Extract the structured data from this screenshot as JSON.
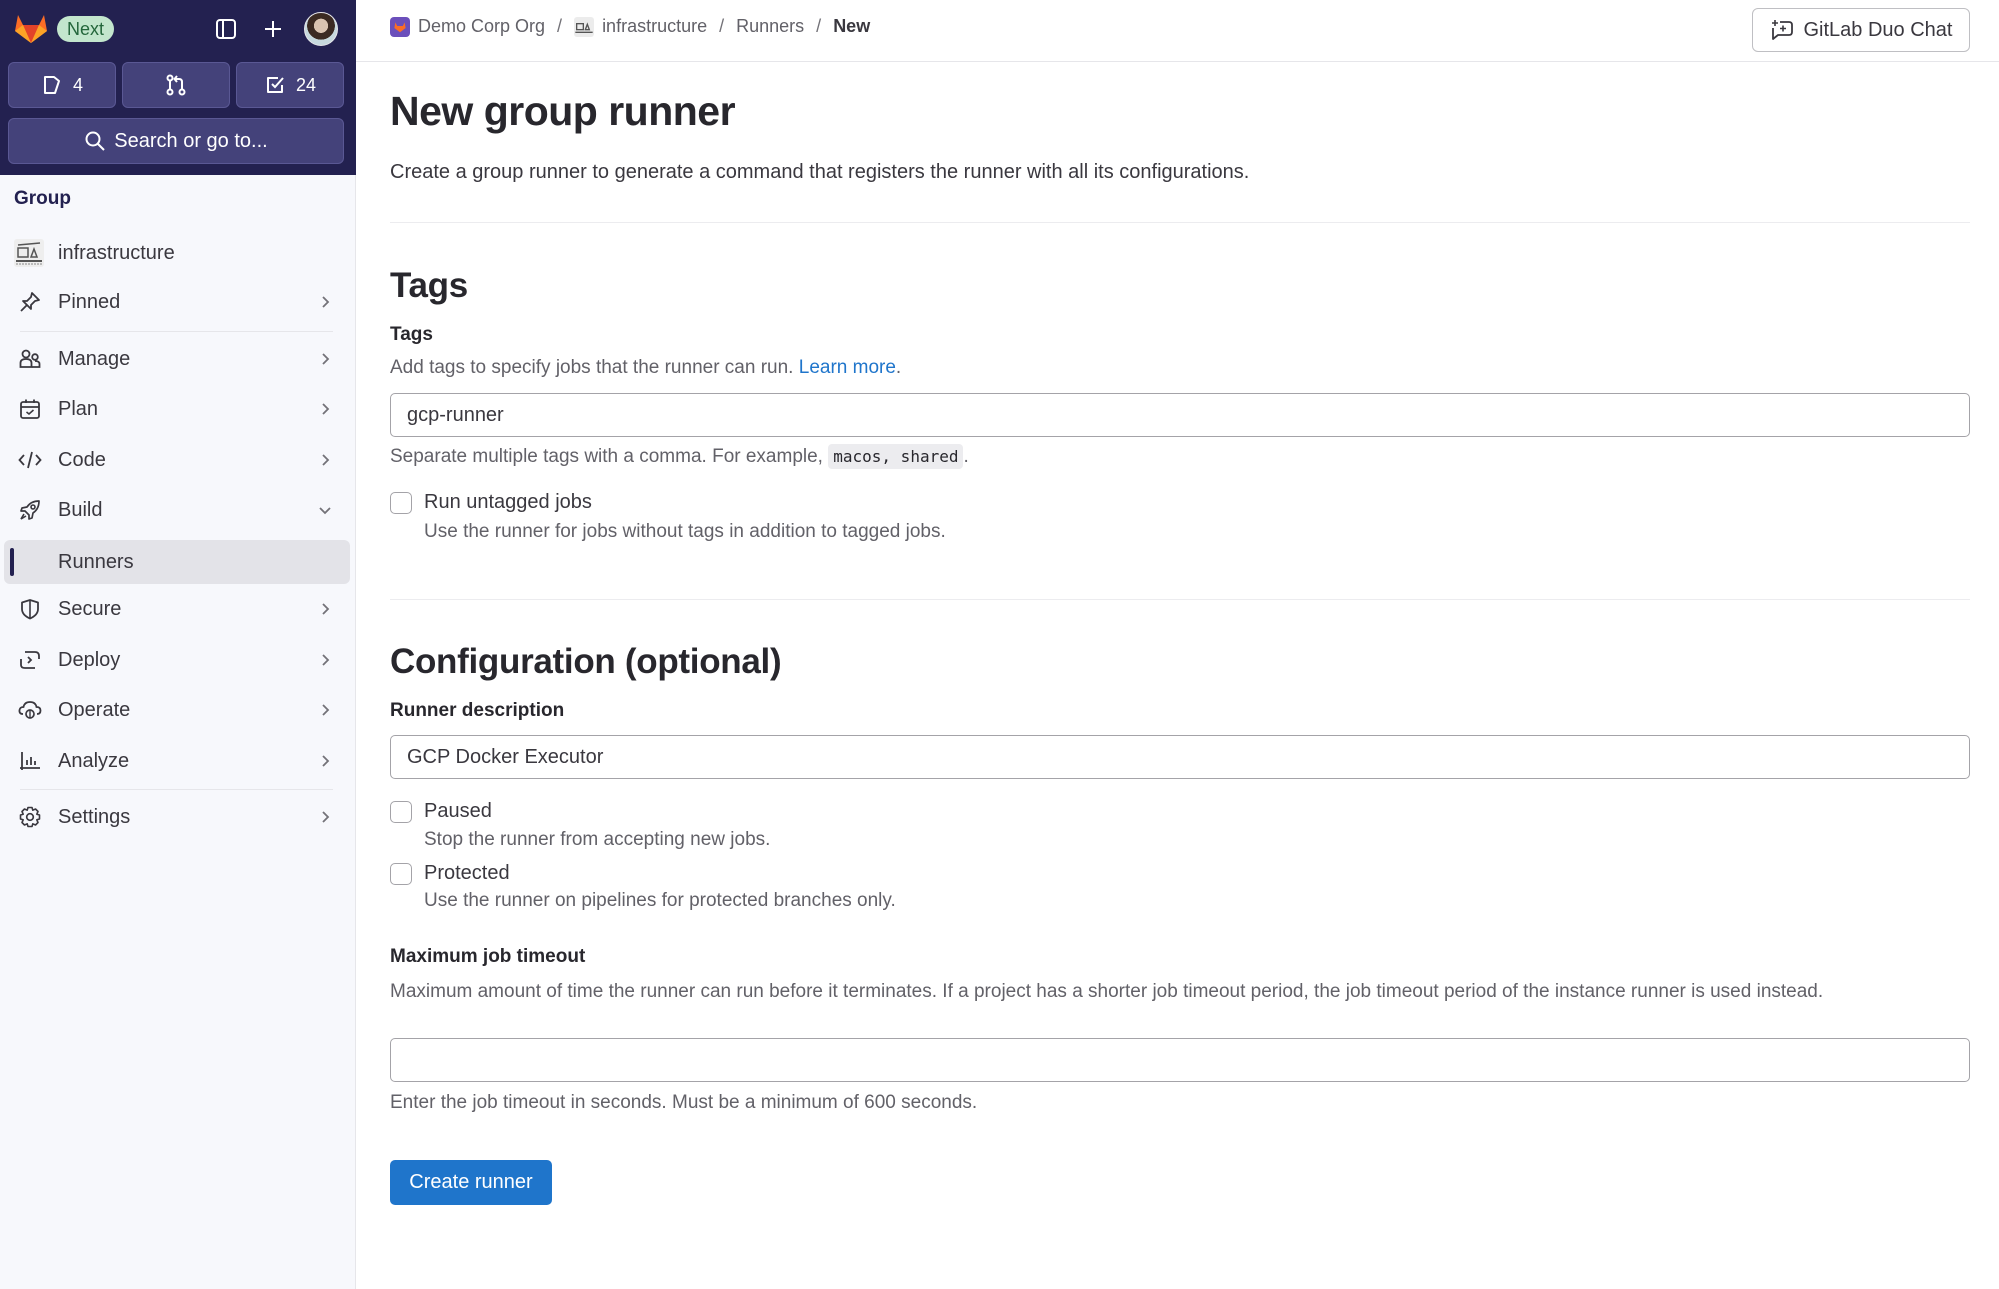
{
  "sidebar": {
    "badge": "Next",
    "counts": {
      "issues": "4",
      "merge_requests": "",
      "todos": "24"
    },
    "search_label": "Search or go to...",
    "context_label": "Group",
    "items": [
      {
        "label": "infrastructure"
      },
      {
        "label": "Pinned"
      },
      {
        "label": "Manage"
      },
      {
        "label": "Plan"
      },
      {
        "label": "Code"
      },
      {
        "label": "Build"
      },
      {
        "label": "Runners"
      },
      {
        "label": "Secure"
      },
      {
        "label": "Deploy"
      },
      {
        "label": "Operate"
      },
      {
        "label": "Analyze"
      },
      {
        "label": "Settings"
      }
    ]
  },
  "topbar": {
    "breadcrumbs": [
      "Demo Corp Org",
      "infrastructure",
      "Runners",
      "New"
    ],
    "separator": "/",
    "duo_chat_label": "GitLab Duo Chat"
  },
  "page": {
    "title": "New group runner",
    "description": "Create a group runner to generate a command that registers the runner with all its configurations."
  },
  "tags_section": {
    "heading": "Tags",
    "field_label": "Tags",
    "help_prefix": "Add tags to specify jobs that the runner can run. ",
    "help_link": "Learn more",
    "help_suffix": ".",
    "value": "gcp-runner",
    "hint_prefix": "Separate multiple tags with a comma. For example, ",
    "hint_code": "macos, shared",
    "hint_suffix": ".",
    "untagged_label": "Run untagged jobs",
    "untagged_help": "Use the runner for jobs without tags in addition to tagged jobs."
  },
  "config_section": {
    "heading": "Configuration (optional)",
    "description_label": "Runner description",
    "description_value": "GCP Docker Executor",
    "paused_label": "Paused",
    "paused_help": "Stop the runner from accepting new jobs.",
    "protected_label": "Protected",
    "protected_help": "Use the runner on pipelines for protected branches only.",
    "timeout_label": "Maximum job timeout",
    "timeout_help": "Maximum amount of time the runner can run before it terminates. If a project has a shorter job timeout period, the job timeout period of the instance runner is used instead.",
    "timeout_value": "",
    "timeout_hint": "Enter the job timeout in seconds. Must be a minimum of 600 seconds."
  },
  "actions": {
    "submit_label": "Create runner"
  },
  "colors": {
    "sidebar_header": "#232150",
    "primary": "#1f75cb",
    "badge_bg": "#c3e6cd",
    "badge_text": "#24663b"
  }
}
